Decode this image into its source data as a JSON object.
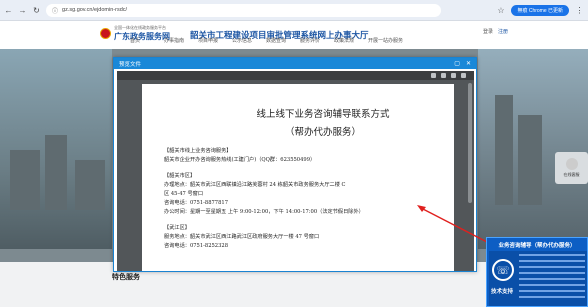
{
  "browser": {
    "url": "gz.sg.gov.cn/ejdomin-rsdc/",
    "profile_badge": "無痕 Chrome 已更新"
  },
  "site": {
    "logo_small": "全国一体化在线政务服务平台",
    "logo_big": "广东政务服务网",
    "title": "韶关市工程建设项目审批管理系统网上办事大厅",
    "login": "登录",
    "register": "注册",
    "nav": [
      "首页",
      "办事指南",
      "项目申报",
      "公示信息",
      "数据查询",
      "服务评价",
      "政策法规",
      "开展一站办服务"
    ],
    "special_services": "特色服务",
    "float_label": "在线客服"
  },
  "modal": {
    "title": "预览文件",
    "restore_icon": "window-restore-icon",
    "close_icon": "close-icon"
  },
  "document": {
    "title": "线上线下业务咨询辅导联系方式",
    "subtitle": "（帮办代办服务）",
    "sections": [
      {
        "head": "【韶关市线上业务咨询服务】",
        "lines": [
          "韶关市企业开办咨询服务热线(工建门户)（QQ群：623550499）"
        ]
      },
      {
        "head": "【韶关市区】",
        "lines": [
          "办理地点：韶关市武江区西联镇沿江路芙蓉村 24 栋韶关市政务服务大厅二楼 C",
          "区 45-47 号窗口",
          "咨询电话：0751-8877817",
          "办公时间：星期一至星期五 上午 9:00-12:00，下午 14:00-17:00（法定节假日除外）"
        ]
      },
      {
        "head": "【武江区】",
        "lines": [
          "服务地点：韶关市武江区西江路武江区政府服务大厅一楼 47 号窗口",
          "咨询电话：0751-8252328"
        ]
      }
    ]
  },
  "promo": {
    "title": "业务咨询辅导（帮办代办服务）",
    "label": "技术支持"
  }
}
